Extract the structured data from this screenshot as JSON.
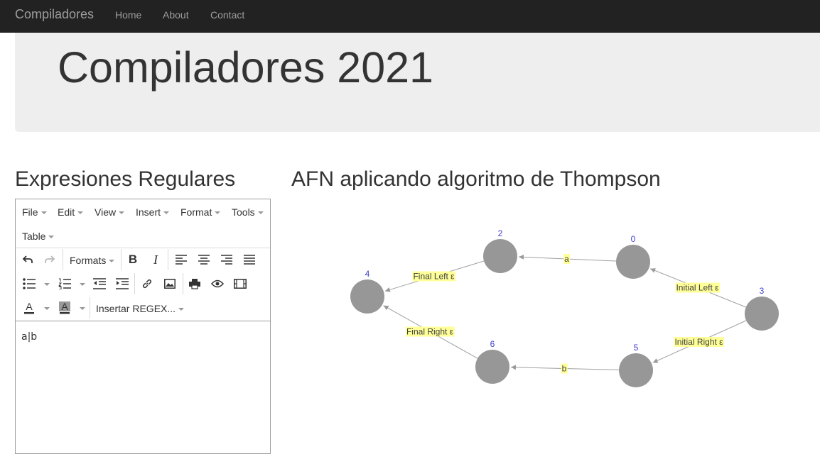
{
  "navbar": {
    "brand": "Compiladores",
    "links": [
      "Home",
      "About",
      "Contact"
    ]
  },
  "jumbotron": {
    "title": "Compiladores 2021"
  },
  "left_section": {
    "heading": "Expresiones Regulares"
  },
  "right_section": {
    "heading": "AFN aplicando algoritmo de Thompson"
  },
  "editor": {
    "menu": [
      "File",
      "Edit",
      "View",
      "Insert",
      "Format",
      "Tools",
      "Table"
    ],
    "formats_label": "Formats",
    "regex_dropdown": "Insertar REGEX...",
    "content": "a|b",
    "toolbar_icons": [
      "undo-icon",
      "redo-icon",
      "bold-icon",
      "italic-icon",
      "align-left-icon",
      "align-center-icon",
      "align-right-icon",
      "align-justify-icon",
      "bullet-list-icon",
      "numbered-list-icon",
      "outdent-icon",
      "indent-icon",
      "link-icon",
      "image-icon",
      "print-icon",
      "preview-icon",
      "media-icon",
      "text-color-icon",
      "background-color-icon"
    ]
  },
  "graph": {
    "node_color": "#979797",
    "node_label_color": "#3e3ecc",
    "edge_label_bg": "#ffff99",
    "nodes": [
      "0",
      "2",
      "4",
      "3",
      "5",
      "6"
    ],
    "edges": [
      {
        "from": "0",
        "to": "2",
        "label": "a"
      },
      {
        "from": "2",
        "to": "4",
        "label": "Final Left ε"
      },
      {
        "from": "3",
        "to": "0",
        "label": "Initial Left ε"
      },
      {
        "from": "3",
        "to": "5",
        "label": "Initial Right ε"
      },
      {
        "from": "5",
        "to": "6",
        "label": "b"
      },
      {
        "from": "6",
        "to": "4",
        "label": "Final Right ε"
      }
    ]
  }
}
